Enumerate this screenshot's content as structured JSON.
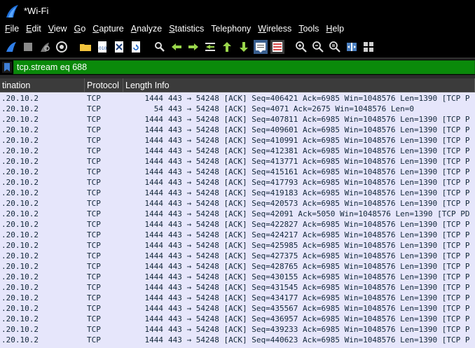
{
  "window": {
    "title": "*Wi-Fi"
  },
  "menu": [
    {
      "label": "File",
      "ul": "F",
      "rest": "ile"
    },
    {
      "label": "Edit",
      "ul": "E",
      "rest": "dit"
    },
    {
      "label": "View",
      "ul": "V",
      "rest": "iew"
    },
    {
      "label": "Go",
      "ul": "G",
      "rest": "o"
    },
    {
      "label": "Capture",
      "ul": "C",
      "rest": "apture"
    },
    {
      "label": "Analyze",
      "ul": "A",
      "rest": "nalyze"
    },
    {
      "label": "Statistics",
      "ul": "S",
      "rest": "tatistics"
    },
    {
      "label": "Telephony",
      "ul": "",
      "rest": "Telephony"
    },
    {
      "label": "Wireless",
      "ul": "W",
      "rest": "ireless"
    },
    {
      "label": "Tools",
      "ul": "T",
      "rest": "ools"
    },
    {
      "label": "Help",
      "ul": "H",
      "rest": "elp"
    }
  ],
  "filter": {
    "value": "tcp.stream eq 688"
  },
  "columns": {
    "destination": "tination",
    "protocol": "Protocol",
    "length": "Length",
    "info": "Info"
  },
  "rows": [
    {
      "dst": ".20.10.2",
      "proto": "TCP",
      "len": "1444",
      "info": "443 → 54248 [ACK] Seq=406421 Ack=6985 Win=1048576 Len=1390 [TCP P"
    },
    {
      "dst": ".20.10.2",
      "proto": "TCP",
      "len": "54",
      "info": "443 → 54248 [ACK] Seq=4071 Ack=2675 Win=1048576 Len=0"
    },
    {
      "dst": ".20.10.2",
      "proto": "TCP",
      "len": "1444",
      "info": "443 → 54248 [ACK] Seq=407811 Ack=6985 Win=1048576 Len=1390 [TCP P"
    },
    {
      "dst": ".20.10.2",
      "proto": "TCP",
      "len": "1444",
      "info": "443 → 54248 [ACK] Seq=409601 Ack=6985 Win=1048576 Len=1390 [TCP P"
    },
    {
      "dst": ".20.10.2",
      "proto": "TCP",
      "len": "1444",
      "info": "443 → 54248 [ACK] Seq=410991 Ack=6985 Win=1048576 Len=1390 [TCP P"
    },
    {
      "dst": ".20.10.2",
      "proto": "TCP",
      "len": "1444",
      "info": "443 → 54248 [ACK] Seq=412381 Ack=6985 Win=1048576 Len=1390 [TCP P"
    },
    {
      "dst": ".20.10.2",
      "proto": "TCP",
      "len": "1444",
      "info": "443 → 54248 [ACK] Seq=413771 Ack=6985 Win=1048576 Len=1390 [TCP P"
    },
    {
      "dst": ".20.10.2",
      "proto": "TCP",
      "len": "1444",
      "info": "443 → 54248 [ACK] Seq=415161 Ack=6985 Win=1048576 Len=1390 [TCP P"
    },
    {
      "dst": ".20.10.2",
      "proto": "TCP",
      "len": "1444",
      "info": "443 → 54248 [ACK] Seq=417793 Ack=6985 Win=1048576 Len=1390 [TCP P"
    },
    {
      "dst": ".20.10.2",
      "proto": "TCP",
      "len": "1444",
      "info": "443 → 54248 [ACK] Seq=419183 Ack=6985 Win=1048576 Len=1390 [TCP P"
    },
    {
      "dst": ".20.10.2",
      "proto": "TCP",
      "len": "1444",
      "info": "443 → 54248 [ACK] Seq=420573 Ack=6985 Win=1048576 Len=1390 [TCP P"
    },
    {
      "dst": ".20.10.2",
      "proto": "TCP",
      "len": "1444",
      "info": "443 → 54248 [ACK] Seq=42091 Ack=5050 Win=1048576 Len=1390 [TCP PD"
    },
    {
      "dst": ".20.10.2",
      "proto": "TCP",
      "len": "1444",
      "info": "443 → 54248 [ACK] Seq=422827 Ack=6985 Win=1048576 Len=1390 [TCP P"
    },
    {
      "dst": ".20.10.2",
      "proto": "TCP",
      "len": "1444",
      "info": "443 → 54248 [ACK] Seq=424217 Ack=6985 Win=1048576 Len=1390 [TCP P"
    },
    {
      "dst": ".20.10.2",
      "proto": "TCP",
      "len": "1444",
      "info": "443 → 54248 [ACK] Seq=425985 Ack=6985 Win=1048576 Len=1390 [TCP P"
    },
    {
      "dst": ".20.10.2",
      "proto": "TCP",
      "len": "1444",
      "info": "443 → 54248 [ACK] Seq=427375 Ack=6985 Win=1048576 Len=1390 [TCP P"
    },
    {
      "dst": ".20.10.2",
      "proto": "TCP",
      "len": "1444",
      "info": "443 → 54248 [ACK] Seq=428765 Ack=6985 Win=1048576 Len=1390 [TCP P"
    },
    {
      "dst": ".20.10.2",
      "proto": "TCP",
      "len": "1444",
      "info": "443 → 54248 [ACK] Seq=430155 Ack=6985 Win=1048576 Len=1390 [TCP P"
    },
    {
      "dst": ".20.10.2",
      "proto": "TCP",
      "len": "1444",
      "info": "443 → 54248 [ACK] Seq=431545 Ack=6985 Win=1048576 Len=1390 [TCP P"
    },
    {
      "dst": ".20.10.2",
      "proto": "TCP",
      "len": "1444",
      "info": "443 → 54248 [ACK] Seq=434177 Ack=6985 Win=1048576 Len=1390 [TCP P"
    },
    {
      "dst": ".20.10.2",
      "proto": "TCP",
      "len": "1444",
      "info": "443 → 54248 [ACK] Seq=435567 Ack=6985 Win=1048576 Len=1390 [TCP P"
    },
    {
      "dst": ".20.10.2",
      "proto": "TCP",
      "len": "1444",
      "info": "443 → 54248 [ACK] Seq=436957 Ack=6985 Win=1048576 Len=1390 [TCP P"
    },
    {
      "dst": ".20.10.2",
      "proto": "TCP",
      "len": "1444",
      "info": "443 → 54248 [ACK] Seq=439233 Ack=6985 Win=1048576 Len=1390 [TCP P"
    },
    {
      "dst": ".20.10.2",
      "proto": "TCP",
      "len": "1444",
      "info": "443 → 54248 [ACK] Seq=440623 Ack=6985 Win=1048576 Len=1390 [TCP P"
    }
  ],
  "icons": {
    "shark_fin": "shark-fin-icon",
    "stop": "stop-icon",
    "restart": "restart-icon",
    "options": "capture-options-icon",
    "open": "open-file-icon",
    "save": "save-file-icon",
    "close": "close-file-icon",
    "reload": "reload-icon",
    "find": "find-icon",
    "back": "back-icon",
    "forward": "forward-icon",
    "goto": "goto-packet-icon",
    "first": "first-packet-icon",
    "last": "last-packet-icon",
    "autoscroll": "autoscroll-icon",
    "colorize": "colorize-icon",
    "zoom_in": "zoom-in-icon",
    "zoom_out": "zoom-out-icon",
    "zoom_normal": "zoom-normal-icon",
    "resize_columns": "resize-columns-icon",
    "layout": "layout-icon"
  }
}
